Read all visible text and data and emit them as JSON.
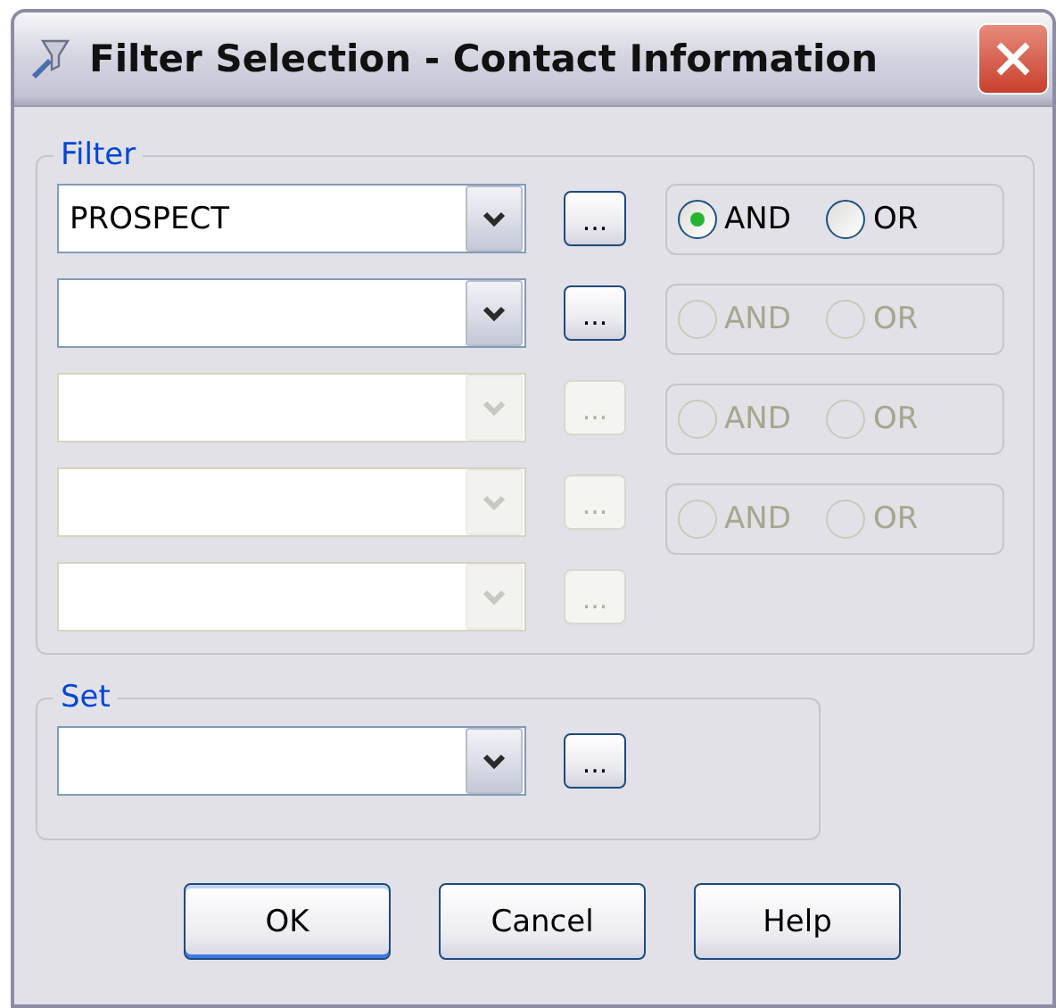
{
  "window": {
    "title": "Filter Selection - Contact Information"
  },
  "filter": {
    "legend": "Filter",
    "rows": [
      {
        "value": "PROSPECT",
        "disabled": false,
        "browse": "..."
      },
      {
        "disabled": false,
        "browse": "..."
      },
      {
        "disabled": true,
        "browse": "..."
      },
      {
        "disabled": true,
        "browse": "..."
      },
      {
        "disabled": true,
        "browse": "..."
      }
    ],
    "connectors": [
      {
        "disabled": false,
        "options": [
          {
            "label": "AND",
            "selected": true
          },
          {
            "label": "OR",
            "selected": false
          }
        ]
      },
      {
        "disabled": true,
        "options": [
          {
            "label": "AND",
            "selected": false
          },
          {
            "label": "OR",
            "selected": false
          }
        ]
      },
      {
        "disabled": true,
        "options": [
          {
            "label": "AND",
            "selected": false
          },
          {
            "label": "OR",
            "selected": false
          }
        ]
      },
      {
        "disabled": true,
        "options": [
          {
            "label": "AND",
            "selected": false
          },
          {
            "label": "OR",
            "selected": false
          }
        ]
      }
    ]
  },
  "set": {
    "legend": "Set",
    "disabled": false,
    "browse": "..."
  },
  "buttons": [
    "OK",
    "Cancel",
    "Help"
  ]
}
